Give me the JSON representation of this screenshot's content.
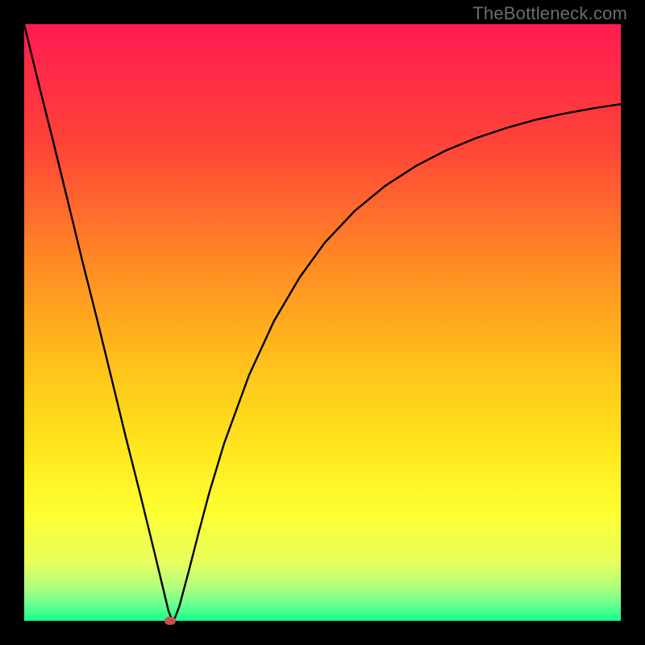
{
  "watermark": "TheBottleneck.com",
  "marker_color": "#c6524a",
  "chart_data": {
    "type": "line",
    "title": "",
    "xlabel": "",
    "ylabel": "",
    "xlim": [
      0,
      100
    ],
    "ylim": [
      0,
      100
    ],
    "grid": false,
    "legend": false,
    "background_gradient": {
      "type": "vertical",
      "stops": [
        {
          "pos": 0.0,
          "color": "#ff1b50"
        },
        {
          "pos": 0.2,
          "color": "#ff4338"
        },
        {
          "pos": 0.4,
          "color": "#ff8a24"
        },
        {
          "pos": 0.58,
          "color": "#ffc41a"
        },
        {
          "pos": 0.72,
          "color": "#ffe81e"
        },
        {
          "pos": 0.82,
          "color": "#fdff32"
        },
        {
          "pos": 0.9,
          "color": "#e8ff5c"
        },
        {
          "pos": 0.94,
          "color": "#b7ff7a"
        },
        {
          "pos": 0.97,
          "color": "#6fff8f"
        },
        {
          "pos": 1.0,
          "color": "#18ff8a"
        }
      ]
    },
    "series": [
      {
        "name": "bottleneck-curve",
        "color": "#000000",
        "x": [
          0.0,
          2.4,
          4.9,
          7.3,
          9.7,
          12.2,
          14.6,
          17.0,
          19.5,
          21.9,
          24.2,
          24.7,
          25.0,
          25.3,
          26.0,
          27.6,
          29.3,
          31.0,
          33.5,
          37.7,
          41.9,
          46.2,
          50.4,
          55.4,
          60.5,
          65.6,
          70.6,
          75.7,
          80.8,
          85.8,
          90.9,
          96.0,
          100.0
        ],
        "y": [
          100.0,
          90.1,
          80.2,
          70.4,
          60.5,
          50.6,
          40.8,
          30.9,
          21.0,
          11.2,
          1.6,
          0.4,
          0.0,
          0.6,
          2.4,
          8.4,
          15.0,
          21.4,
          29.7,
          41.2,
          50.3,
          57.6,
          63.4,
          68.7,
          72.9,
          76.2,
          78.8,
          80.9,
          82.6,
          84.0,
          85.1,
          86.0,
          86.6
        ]
      }
    ],
    "marker": {
      "x": 24.5,
      "y": 0.0
    }
  }
}
